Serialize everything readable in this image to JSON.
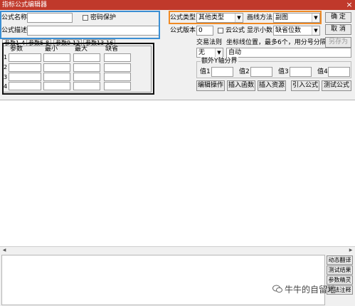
{
  "window": {
    "title": "指标公式编辑器",
    "close_symbol": "×"
  },
  "form": {
    "formula_name_label": "公式名称",
    "formula_name_value": "",
    "password_protect_label": "密码保护",
    "formula_desc_label": "公式描述",
    "formula_desc_value": "",
    "formula_type_label": "公式类型",
    "formula_type_value": "其他类型",
    "draw_method_label": "画线方法",
    "draw_method_value": "副图",
    "version_label": "公式版本",
    "version_value": "0",
    "cloud_formula_label": "云公式",
    "display_decimals_label": "显示小数",
    "display_decimals_value": "缺省位数",
    "trade_rule_label": "交易法则",
    "trade_rule_value": "无",
    "coord_hint": "坐标线位置，最多6个，用分号分隔",
    "coord_value": "自动",
    "extra_y_label": "额外Y轴分界",
    "values": [
      "值1",
      "值2",
      "值3",
      "值4"
    ]
  },
  "buttons": {
    "ok": "确  定",
    "cancel": "取  消",
    "save_as": "另存为",
    "edit_op": "编辑操作",
    "insert_func": "插入函数",
    "insert_res": "插入资源",
    "import_formula": "引入公式",
    "test_formula": "测试公式"
  },
  "tabs": [
    "参数1-4",
    "参数5-8",
    "参数9-12",
    "参数13-16"
  ],
  "param_table": {
    "headers": [
      "参数",
      "最小",
      "最大",
      "缺省"
    ],
    "row_numbers": [
      "1",
      "2",
      "3",
      "4"
    ]
  },
  "side_buttons": [
    "动态翻译",
    "测试结果",
    "参数精灵",
    "用法注释"
  ],
  "watermark": "牛牛的自留地",
  "colors": {
    "titlebar": "#c0392b",
    "annot_blue": "#3b8fd4",
    "annot_orange": "#f08a24",
    "annot_black": "#111111"
  }
}
